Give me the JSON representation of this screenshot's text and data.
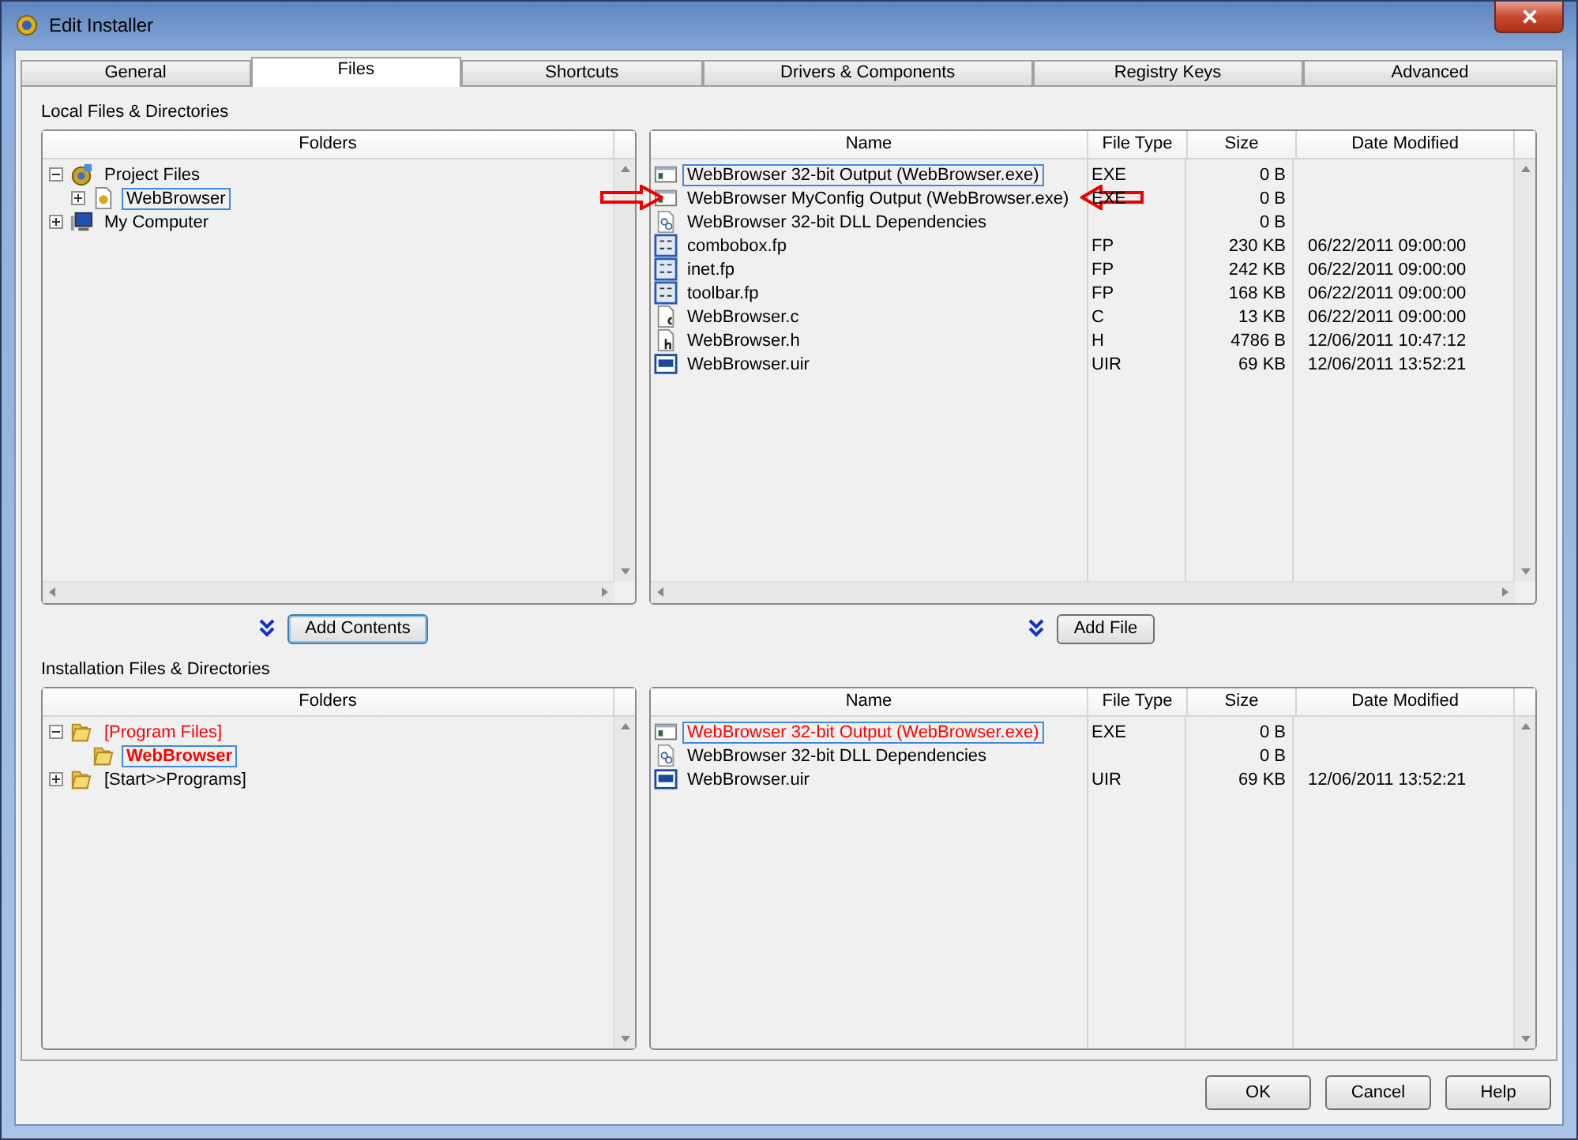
{
  "window": {
    "title": "Edit Installer"
  },
  "tabs": [
    {
      "label": "General",
      "selected": false
    },
    {
      "label": "Files",
      "selected": true
    },
    {
      "label": "Shortcuts",
      "selected": false
    },
    {
      "label": "Drivers & Components",
      "selected": false
    },
    {
      "label": "Registry Keys",
      "selected": false
    },
    {
      "label": "Advanced",
      "selected": false
    }
  ],
  "local": {
    "label": "Local Files & Directories",
    "folders_header": "Folders",
    "tree": [
      {
        "label": "Project Files",
        "kind": "project",
        "expanded": true,
        "selected": false,
        "children": [
          {
            "label": "WebBrowser",
            "kind": "config",
            "expanded": false,
            "selected": true
          }
        ]
      },
      {
        "label": "My Computer",
        "kind": "computer",
        "expanded": false,
        "selected": false
      }
    ],
    "columns": [
      "Name",
      "File Type",
      "Size",
      "Date Modified"
    ],
    "files": [
      {
        "name": "WebBrowser 32-bit Output (WebBrowser.exe)",
        "kind": "output",
        "type": "EXE",
        "size": "0  B",
        "selected": true,
        "arrows": false
      },
      {
        "name": "WebBrowser MyConfig Output (WebBrowser.exe)",
        "kind": "output",
        "type": "EXE",
        "size": "0  B",
        "selected": false,
        "arrows": true
      },
      {
        "name": "WebBrowser 32-bit DLL Dependencies",
        "kind": "dependencies",
        "size": "0  B",
        "selected": false,
        "arrows": false
      },
      {
        "name": "combobox.fp",
        "kind": "fp",
        "type": "FP",
        "size": "230 KB",
        "date": "06/22/2011 09:00:00",
        "selected": false,
        "arrows": false
      },
      {
        "name": "inet.fp",
        "kind": "fp",
        "type": "FP",
        "size": "242 KB",
        "date": "06/22/2011 09:00:00",
        "selected": false,
        "arrows": false
      },
      {
        "name": "toolbar.fp",
        "kind": "fp",
        "type": "FP",
        "size": "168 KB",
        "date": "06/22/2011 09:00:00",
        "selected": false,
        "arrows": false
      },
      {
        "name": "WebBrowser.c",
        "kind": "c",
        "type": "C",
        "size": "13 KB",
        "date": "06/22/2011 09:00:00",
        "selected": false,
        "arrows": false
      },
      {
        "name": "WebBrowser.h",
        "kind": "h",
        "type": "H",
        "size": "4786  B",
        "date": "12/06/2011 10:47:12",
        "selected": false,
        "arrows": false
      },
      {
        "name": "WebBrowser.uir",
        "kind": "uir",
        "type": "UIR",
        "size": "69 KB",
        "date": "12/06/2011 13:52:21",
        "selected": false,
        "arrows": false
      }
    ]
  },
  "add_buttons": [
    {
      "label": "Add Contents",
      "focused": true
    },
    {
      "label": "Add File",
      "focused": false
    }
  ],
  "install": {
    "label": "Installation Files & Directories",
    "folders_header": "Folders",
    "tree": [
      {
        "label": "[Program Files]",
        "kind": "folder",
        "expanded": true,
        "selected": false,
        "color": "#ff0000",
        "children": [
          {
            "label": "WebBrowser",
            "kind": "folder",
            "selected": true,
            "emphasized": true,
            "color": "#ff0000"
          }
        ]
      },
      {
        "label": "[Start>>Programs]",
        "kind": "folder",
        "expanded": false,
        "selected": false
      }
    ],
    "columns": [
      "Name",
      "File Type",
      "Size",
      "Date Modified"
    ],
    "files": [
      {
        "name": "WebBrowser 32-bit Output (WebBrowser.exe)",
        "kind": "output",
        "type": "EXE",
        "size": "0  B",
        "selected": true,
        "color": "#ff0000"
      },
      {
        "name": "WebBrowser 32-bit DLL Dependencies",
        "kind": "dependencies",
        "size": "0  B",
        "selected": false
      },
      {
        "name": "WebBrowser.uir",
        "kind": "uir",
        "type": "UIR",
        "size": "69 KB",
        "date": "12/06/2011 13:52:21",
        "selected": false
      }
    ]
  },
  "buttons": [
    "OK",
    "Cancel",
    "Help"
  ]
}
